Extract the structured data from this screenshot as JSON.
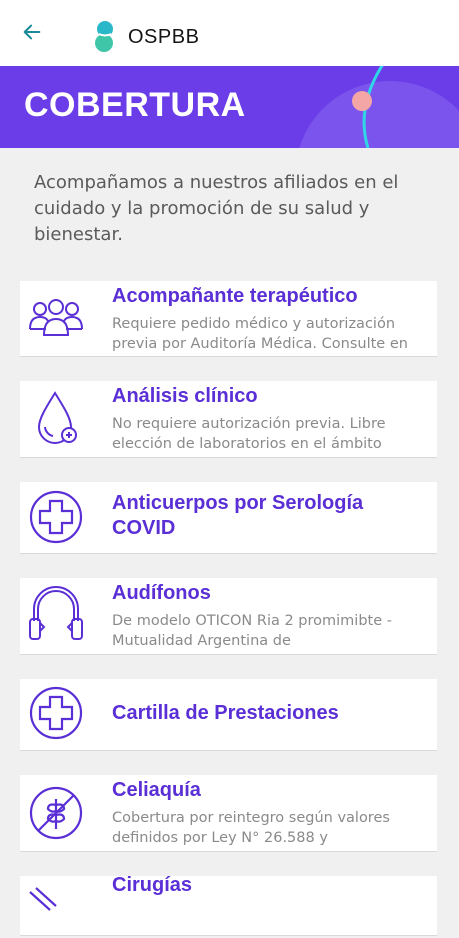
{
  "header": {
    "app_name": "OSPBB",
    "back_icon": "arrow-left-icon",
    "logo_icon": "ospbb-logo-icon"
  },
  "hero": {
    "title": "COBERTURA",
    "color": "#6a3de8"
  },
  "intro": "Acompañamos a nuestros afiliados en el cuidado y la promoción de su salud y bienestar.",
  "items": [
    {
      "title": "Acompañante terapéutico",
      "desc1": "Requiere pedido médico y autorización",
      "desc2": "previa por Auditoría Médica. Consulte en",
      "icon": "group-people-icon"
    },
    {
      "title": "Análisis clínico",
      "desc1": "No requiere autorización previa. Libre",
      "desc2": "elección de laboratorios en el ámbito",
      "icon": "blood-drop-icon"
    },
    {
      "title": "Anticuerpos por Serología",
      "title2": "COVID",
      "icon": "medical-cross-icon"
    },
    {
      "title": "Audífonos",
      "desc1": "De modelo OTICON Ria 2 promimibte -",
      "desc2": "Mutualidad Argentina de",
      "icon": "headphones-icon"
    },
    {
      "title": "Cartilla de Prestaciones",
      "icon": "medical-cross-icon"
    },
    {
      "title": "Celiaquía",
      "desc1": "Cobertura por reintegro según valores",
      "desc2": "definidos por Ley N° 26.588 y",
      "icon": "gluten-free-icon"
    },
    {
      "title": "Cirugías",
      "icon": "surgery-icon"
    }
  ],
  "colors": {
    "accent": "#5a2fd6",
    "teal": "#2ab7c9",
    "pink": "#f4a6a6"
  }
}
